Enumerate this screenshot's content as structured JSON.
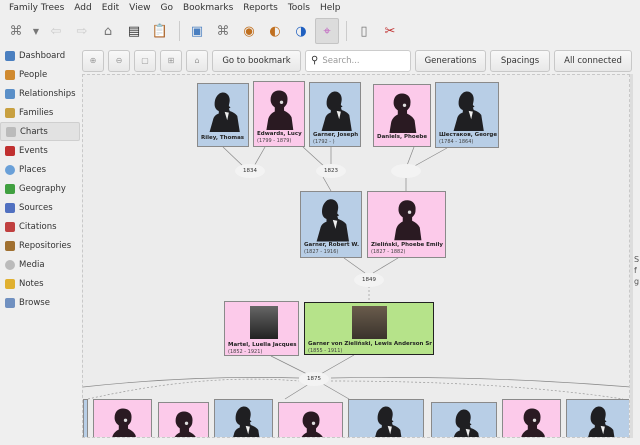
{
  "menu": [
    "Family Trees",
    "Add",
    "Edit",
    "View",
    "Go",
    "Bookmarks",
    "Reports",
    "Tools",
    "Help"
  ],
  "sidebar": [
    {
      "label": "Dashboard",
      "color": "#4a7fc0"
    },
    {
      "label": "People",
      "color": "#d08a30"
    },
    {
      "label": "Relationships",
      "color": "#5a8fc8"
    },
    {
      "label": "Families",
      "color": "#c8a040"
    },
    {
      "label": "Charts",
      "color": "#9a9a9a"
    },
    {
      "label": "Events",
      "color": "#c03030"
    },
    {
      "label": "Places",
      "color": "#6aa0d8"
    },
    {
      "label": "Geography",
      "color": "#40a040"
    },
    {
      "label": "Sources",
      "color": "#5070c0"
    },
    {
      "label": "Citations",
      "color": "#c04040"
    },
    {
      "label": "Repositories",
      "color": "#a07030"
    },
    {
      "label": "Media",
      "color": "#aaaaaa"
    },
    {
      "label": "Notes",
      "color": "#e0b030"
    },
    {
      "label": "Browse",
      "color": "#7090c0"
    }
  ],
  "chartbar": {
    "bookmark": "Go to bookmark",
    "search_placeholder": "Search...",
    "generations": "Generations",
    "spacings": "Spacings",
    "all_connected": "All connected"
  },
  "people": {
    "riley": {
      "name": "Riley, Thomas",
      "dates": ""
    },
    "edwards": {
      "name": "Edwards, Lucy",
      "dates": "(1799 - 1879)"
    },
    "garner_joseph": {
      "name": "Garner, Joseph",
      "dates": "(1792 - )"
    },
    "daniels": {
      "name": "Daniels, Phoebe",
      "dates": ""
    },
    "shestakov": {
      "name": "Шестаков, George",
      "dates": "(1784 - 1864)"
    },
    "garner_robert": {
      "name": "Garner, Robert W.",
      "dates": "(1827 - 1916)"
    },
    "zielinski_phoebe": {
      "name": "Zieliński, Phoebe Emily",
      "dates": "(1827 - 1882)"
    },
    "martel": {
      "name": "Martel, Luella Jacques",
      "dates": "(1852 - 1921)"
    },
    "garner_lewis": {
      "name": "Garner von Zieliński, Lewis Anderson Sr",
      "dates": "(1855 - 1911)"
    }
  },
  "families": [
    "1834",
    "1823",
    "",
    "1849",
    "1875"
  ],
  "clipped_text": [
    "S",
    "f",
    "g"
  ],
  "colors": {
    "male": "#b8cee6",
    "female": "#fccaea",
    "active": "#b6e38a"
  }
}
